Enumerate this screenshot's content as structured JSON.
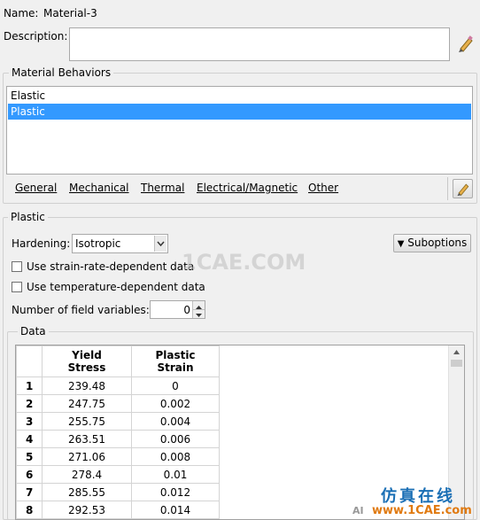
{
  "name_label": "Name:",
  "name_value": "Material-3",
  "description_label": "Description:",
  "description_value": "",
  "behaviors": {
    "title": "Material Behaviors",
    "items": [
      "Elastic",
      "Plastic"
    ],
    "selected": "Plastic"
  },
  "menus": [
    "General",
    "Mechanical",
    "Thermal",
    "Electrical/Magnetic",
    "Other"
  ],
  "plastic": {
    "title": "Plastic",
    "hardening_label": "Hardening:",
    "hardening_value": "Isotropic",
    "suboptions_label": "Suboptions",
    "strain_rate_label": "Use strain-rate-dependent data",
    "temperature_label": "Use temperature-dependent data",
    "field_vars_label": "Number of field variables:",
    "field_vars_value": "0"
  },
  "data": {
    "title": "Data",
    "headers": [
      [
        "Yield",
        "Stress"
      ],
      [
        "Plastic",
        "Strain"
      ]
    ],
    "rows": [
      [
        "1",
        "239.48",
        "0"
      ],
      [
        "2",
        "247.75",
        "0.002"
      ],
      [
        "3",
        "255.75",
        "0.004"
      ],
      [
        "4",
        "263.51",
        "0.006"
      ],
      [
        "5",
        "271.06",
        "0.008"
      ],
      [
        "6",
        "278.4",
        "0.01"
      ],
      [
        "7",
        "285.55",
        "0.012"
      ],
      [
        "8",
        "292.53",
        "0.014"
      ]
    ]
  },
  "watermarks": {
    "center": "1CAE.COM",
    "corner_cn": "仿真在线",
    "corner_url": "www.1CAE.com",
    "corner_small": "AI"
  }
}
